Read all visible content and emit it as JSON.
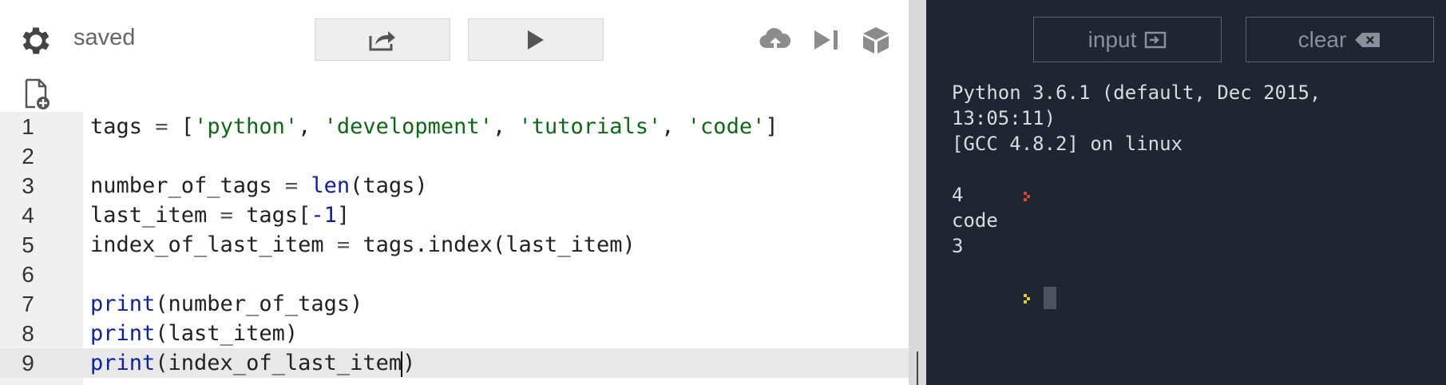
{
  "editor": {
    "status": "saved",
    "icons": {
      "settings": "gear-icon",
      "share": "share-icon",
      "run": "play-icon",
      "cloud": "cloud-upload-icon",
      "step": "step-forward-icon",
      "package": "box-icon",
      "new_file": "new-file-icon"
    },
    "lines": [
      {
        "num": "1",
        "text": "tags = ['python', 'development', 'tutorials', 'code']"
      },
      {
        "num": "2",
        "text": ""
      },
      {
        "num": "3",
        "text": "number_of_tags = len(tags)"
      },
      {
        "num": "4",
        "text": "last_item = tags[-1]"
      },
      {
        "num": "5",
        "text": "index_of_last_item = tags.index(last_item)"
      },
      {
        "num": "6",
        "text": ""
      },
      {
        "num": "7",
        "text": "print(number_of_tags)"
      },
      {
        "num": "8",
        "text": "print(last_item)"
      },
      {
        "num": "9",
        "text": "print(index_of_last_item)"
      }
    ],
    "active_line": "9"
  },
  "console": {
    "input_label": "input",
    "clear_label": "clear",
    "output": [
      "Python 3.6.1 (default, Dec 2015,",
      "13:05:11)",
      "[GCC 4.8.2] on linux",
      "4",
      "code",
      "3"
    ],
    "colors": {
      "background": "#1f2531",
      "prompt_red": "#d9472b",
      "prompt_yellow": "#e7c436"
    }
  }
}
